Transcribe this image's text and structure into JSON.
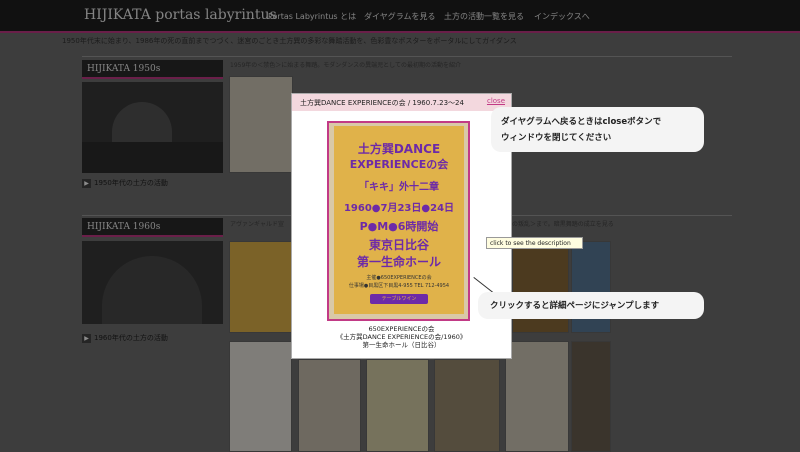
{
  "site": {
    "title": "HIJIKATA portas labyrintus",
    "nav": [
      "Portas Labyrintus とは",
      "ダイヤグラムを見る",
      "土方の活動一覧を見る",
      "インデックスへ"
    ]
  },
  "intro": "1950年代末に始まり、1986年の死の直前までつづく、迷宮のごとき土方巽の多彩な舞踏活動を、色彩豊なポスターをポータルにしてガイダンス",
  "sections": [
    {
      "heading": "HIJIKATA 1950s",
      "description": "1959年の＜禁色＞に始まる舞踏。モダンダンスの異端児としての最初期の活動を紹介",
      "link": "1950年代の土方の活動"
    },
    {
      "heading": "HIJIKATA 1960s",
      "description_left": "アヴァンギャルド宣",
      "description_right": "の叛乱＞まで。暗黒舞踏の成立を見る",
      "link": "1960年代の土方の活動"
    }
  ],
  "modal": {
    "title": "土方巽DANCE EXPERIENCEの会 / 1960.7.23～24",
    "close": "close",
    "caption": [
      "650EXPERIENCEの会",
      "《土方巽DANCE EXPERIENCEの会/1960》",
      "第一生命ホール（日比谷）"
    ]
  },
  "poster": {
    "lines": [
      "土方巽DANCE",
      "EXPERIENCEの会",
      "「キキ」外十二章",
      "1960●7月23日●24日",
      "P●M●6時開始",
      "東京日比谷",
      "第一生命ホール"
    ],
    "small": [
      "主催●650EXPERIENCEの会",
      "仕事場●目黒区下目黒4-955 TEL 712-4954"
    ],
    "banner": "テーブルワイン",
    "colors": {
      "background": "#e0b24a",
      "text": "#6d2aa8"
    }
  },
  "annotations": {
    "callout_top_line1": "ダイヤグラムへ戻るときはcloseボタンで",
    "callout_top_line2": "ウィンドウを閉じてください",
    "callout_bottom": "クリックすると詳細ページにジャンプします",
    "tooltip": "click to see the description"
  },
  "colors": {
    "accent": "#c23a86",
    "header": "#1f1f1f"
  }
}
